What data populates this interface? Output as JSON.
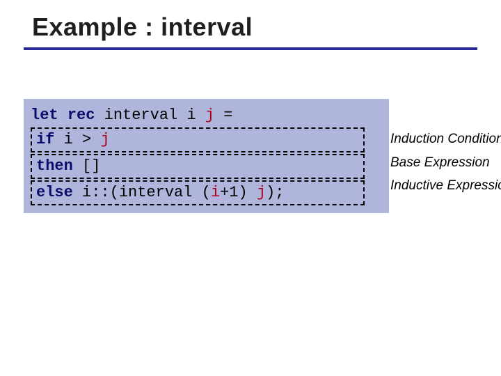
{
  "title": "Example : interval",
  "code": {
    "line1": {
      "let": "let",
      "rec": "rec",
      "rest": " interval i ",
      "j": "j",
      "eq": " ="
    },
    "line2": {
      "indent": "  ",
      "if": "if",
      "mid": "  i > ",
      "j": "j"
    },
    "line3": {
      "indent": "  ",
      "then": "then",
      "rest": " []"
    },
    "line4": {
      "indent": "  ",
      "else": "else",
      "a": " i::(interval (",
      "i2": "i",
      "b": "+1) ",
      "j": "j",
      "c": ");"
    }
  },
  "annotations": {
    "cond": "Induction Condition",
    "base": "Base Expression",
    "ind": "Inductive Expression"
  }
}
